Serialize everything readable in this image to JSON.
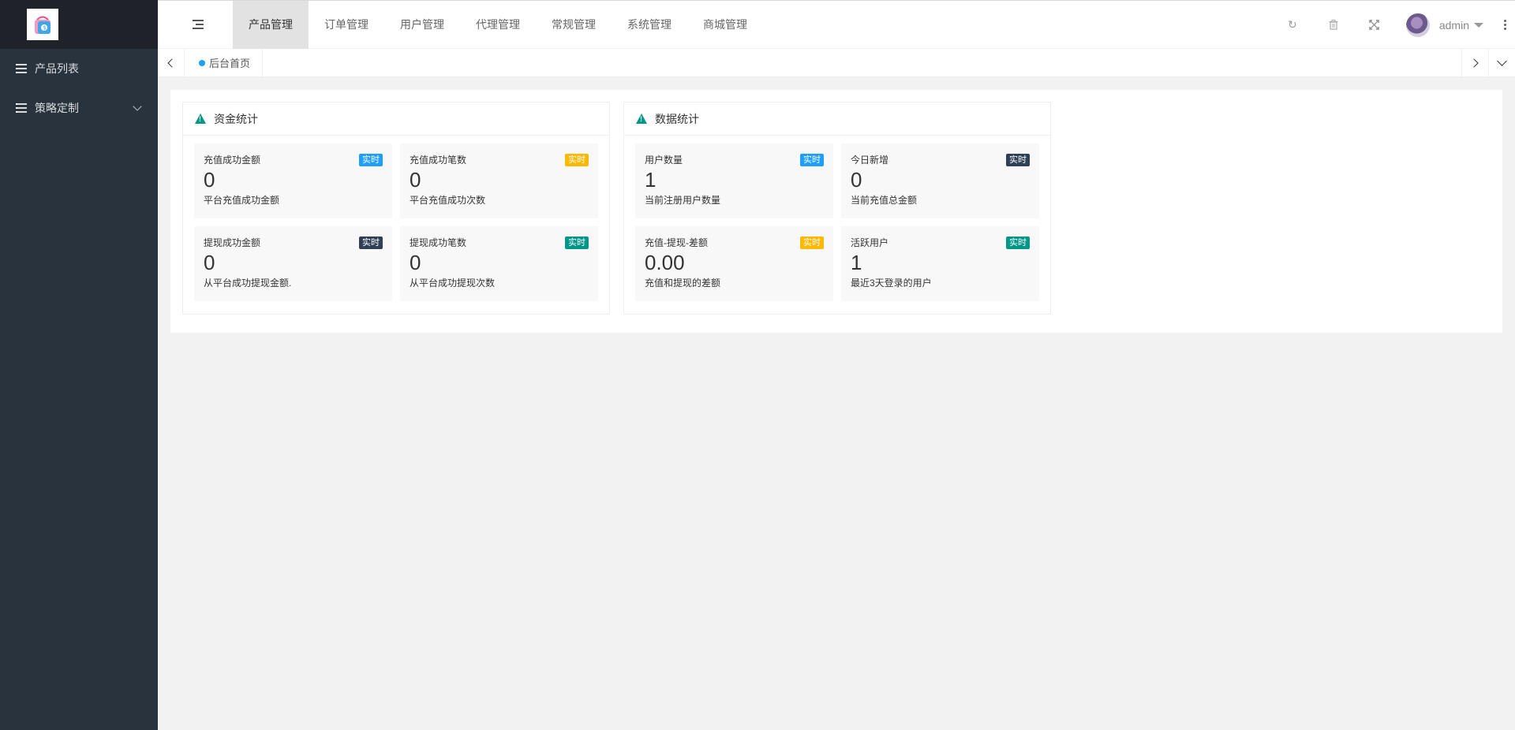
{
  "sidebar": {
    "items": [
      {
        "label": "产品列表"
      },
      {
        "label": "策略定制"
      }
    ]
  },
  "header": {
    "nav": [
      {
        "label": "产品管理"
      },
      {
        "label": "订单管理"
      },
      {
        "label": "用户管理"
      },
      {
        "label": "代理管理"
      },
      {
        "label": "常规管理"
      },
      {
        "label": "系统管理"
      },
      {
        "label": "商城管理"
      }
    ],
    "tools": {
      "refresh": "↻",
      "clear": "🗑",
      "fullscreen": "⤢"
    },
    "user_name": "admin"
  },
  "tabs": {
    "home": "后台首页"
  },
  "panels": {
    "funds": {
      "title": "资金统计",
      "cards": [
        {
          "title": "充值成功金额",
          "badge": "实时",
          "badge_color": "#1e9fff",
          "value": "0",
          "desc": "平台充值成功金额"
        },
        {
          "title": "充值成功笔数",
          "badge": "实时",
          "badge_color": "#ffb800",
          "value": "0",
          "desc": "平台充值成功次数"
        },
        {
          "title": "提现成功金额",
          "badge": "实时",
          "badge_color": "#2f4056",
          "value": "0",
          "desc": "从平台成功提现金额."
        },
        {
          "title": "提现成功笔数",
          "badge": "实时",
          "badge_color": "#009688",
          "value": "0",
          "desc": "从平台成功提现次数"
        }
      ]
    },
    "data": {
      "title": "数据统计",
      "cards": [
        {
          "title": "用户数量",
          "badge": "实时",
          "badge_color": "#1e9fff",
          "value": "1",
          "desc": "当前注册用户数量"
        },
        {
          "title": "今日新增",
          "badge": "实时",
          "badge_color": "#2f4056",
          "value": "0",
          "desc": "当前充值总金额"
        },
        {
          "title": "充值-提现-差额",
          "badge": "实时",
          "badge_color": "#ffb800",
          "value": "0.00",
          "desc": "充值和提现的差额"
        },
        {
          "title": "活跃用户",
          "badge": "实时",
          "badge_color": "#009688",
          "value": "1",
          "desc": "最近3天登录的用户"
        }
      ]
    }
  }
}
